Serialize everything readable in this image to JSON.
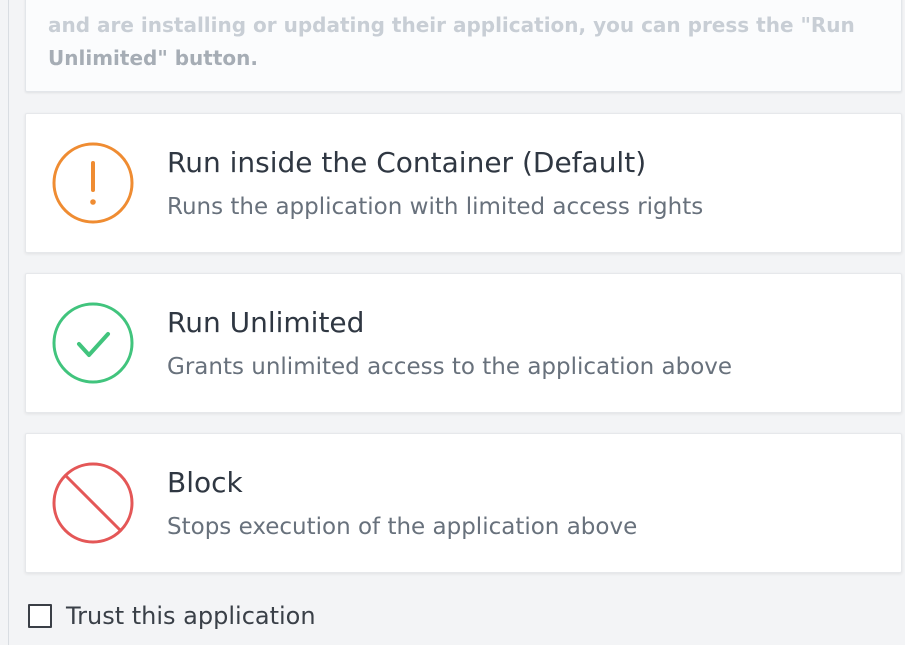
{
  "info_card": {
    "line_1": "and are installing or updating their application, you can press the \"Run",
    "line_2": "Unlimited\" button."
  },
  "options": [
    {
      "title": "Run inside the Container (Default)",
      "description": "Runs the application with limited access rights",
      "icon": "warning-icon",
      "color": "#ef8c32"
    },
    {
      "title": "Run Unlimited",
      "description": "Grants unlimited access to the application above",
      "icon": "check-icon",
      "color": "#41c47d"
    },
    {
      "title": "Block",
      "description": "Stops execution of the application above",
      "icon": "block-icon",
      "color": "#e45757"
    }
  ],
  "trust": {
    "label": "Trust this application",
    "checked": false
  }
}
